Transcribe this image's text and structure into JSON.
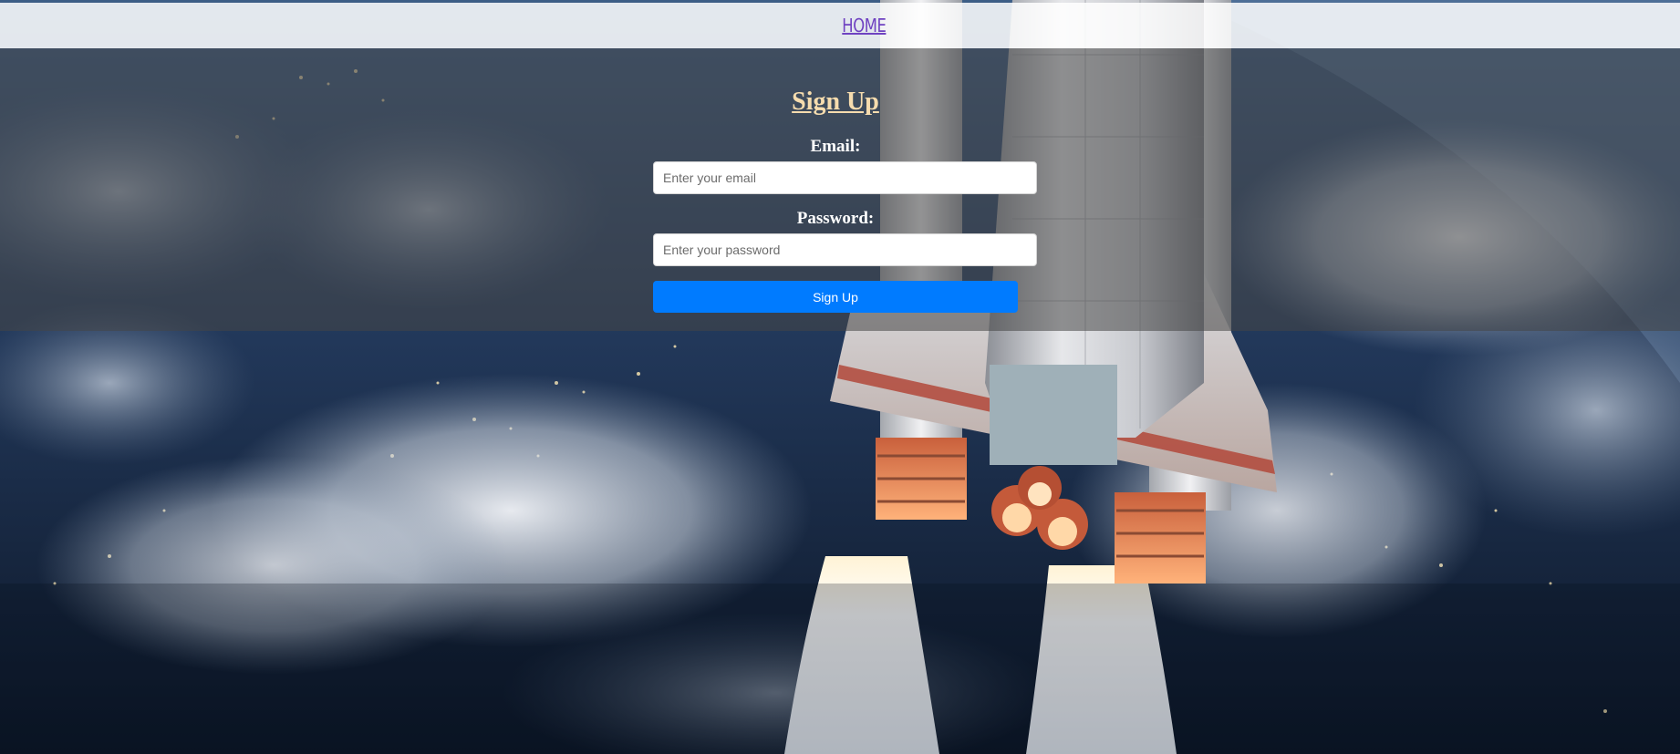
{
  "nav": {
    "home_label": "HOME"
  },
  "form": {
    "title": "Sign Up",
    "email": {
      "label": "Email:",
      "placeholder": "Enter your email",
      "value": ""
    },
    "password": {
      "label": "Password:",
      "placeholder": "Enter your password",
      "value": ""
    },
    "submit_label": "Sign Up"
  },
  "colors": {
    "link": "#6f42c1",
    "title": "#f6dcae",
    "button": "#007bff"
  }
}
